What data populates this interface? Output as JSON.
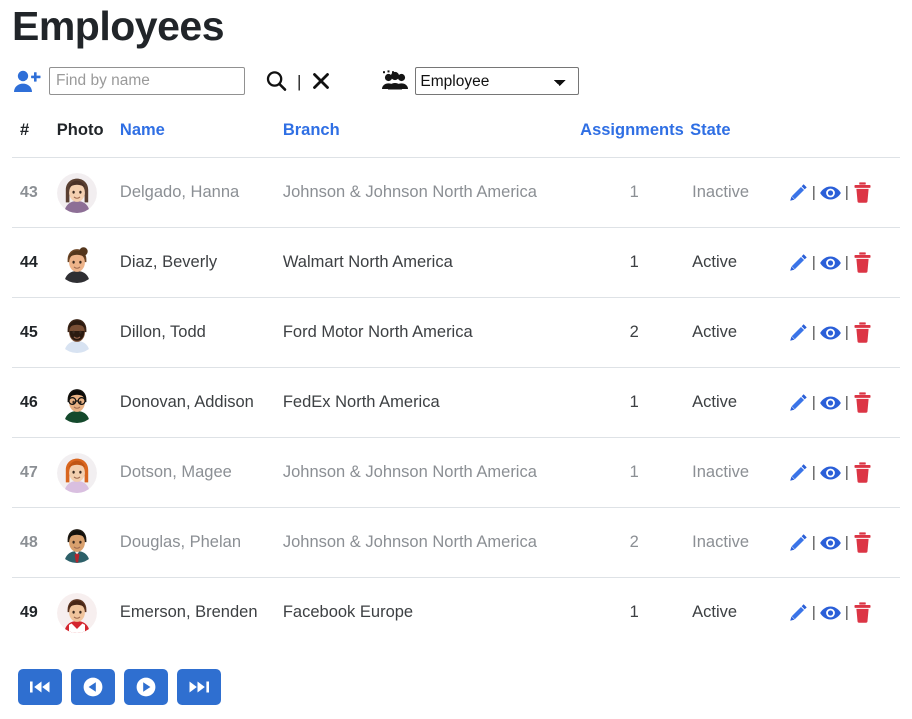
{
  "page_title": "Employees",
  "toolbar": {
    "add_user_icon": "user-plus-icon",
    "search_placeholder": "Find by name",
    "search_value": "",
    "search_icon": "search-icon",
    "separator": "|",
    "clear_icon": "close-icon",
    "group_icon": "users-icon",
    "role_selected": "Employee",
    "role_options": [
      "Employee"
    ]
  },
  "table": {
    "headers": [
      {
        "label": "#",
        "link": false
      },
      {
        "label": "Photo",
        "link": false
      },
      {
        "label": "Name",
        "link": true
      },
      {
        "label": "Branch",
        "link": true
      },
      {
        "label": "Assignments",
        "link": true
      },
      {
        "label": "State",
        "link": true
      }
    ],
    "rows": [
      {
        "num": "43",
        "name": "Delgado, Hanna",
        "branch": "Johnson & Johnson North America",
        "assignments": "1",
        "state": "Inactive",
        "avatar": "woman-dark-hair-purple-top"
      },
      {
        "num": "44",
        "name": "Diaz, Beverly",
        "branch": "Walmart North America",
        "assignments": "1",
        "state": "Active",
        "avatar": "woman-brown-bun"
      },
      {
        "num": "45",
        "name": "Dillon, Todd",
        "branch": "Ford Motor North America",
        "assignments": "2",
        "state": "Active",
        "avatar": "man-beard-lightblue-shirt"
      },
      {
        "num": "46",
        "name": "Donovan, Addison",
        "branch": "FedEx North America",
        "assignments": "1",
        "state": "Active",
        "avatar": "man-glasses-green-sweater"
      },
      {
        "num": "47",
        "name": "Dotson, Magee",
        "branch": "Johnson & Johnson North America",
        "assignments": "1",
        "state": "Inactive",
        "avatar": "woman-red-hair-lilac-top"
      },
      {
        "num": "48",
        "name": "Douglas, Phelan",
        "branch": "Johnson & Johnson North America",
        "assignments": "2",
        "state": "Inactive",
        "avatar": "man-teal-suit-red-tie"
      },
      {
        "num": "49",
        "name": "Emerson, Brenden",
        "branch": "Facebook Europe",
        "assignments": "1",
        "state": "Active",
        "avatar": "man-red-jacket"
      }
    ],
    "row_actions": [
      {
        "name": "edit-icon",
        "title": "Edit"
      },
      {
        "name": "view-icon",
        "title": "View"
      },
      {
        "name": "delete-icon",
        "title": "Delete"
      }
    ]
  },
  "pagination": [
    {
      "name": "first-page-button",
      "icon": "skip-backward-icon"
    },
    {
      "name": "previous-page-button",
      "icon": "circle-arrow-left-icon"
    },
    {
      "name": "next-page-button",
      "icon": "circle-arrow-right-icon"
    },
    {
      "name": "last-page-button",
      "icon": "skip-forward-icon"
    }
  ],
  "colors": {
    "link_blue": "#2f6fe4",
    "action_blue": "#2a5fd8",
    "danger_red": "#dc3545",
    "pager_blue": "#2f6fd0",
    "muted_grey": "#8b8f94",
    "border_grey": "#dee2e6"
  }
}
